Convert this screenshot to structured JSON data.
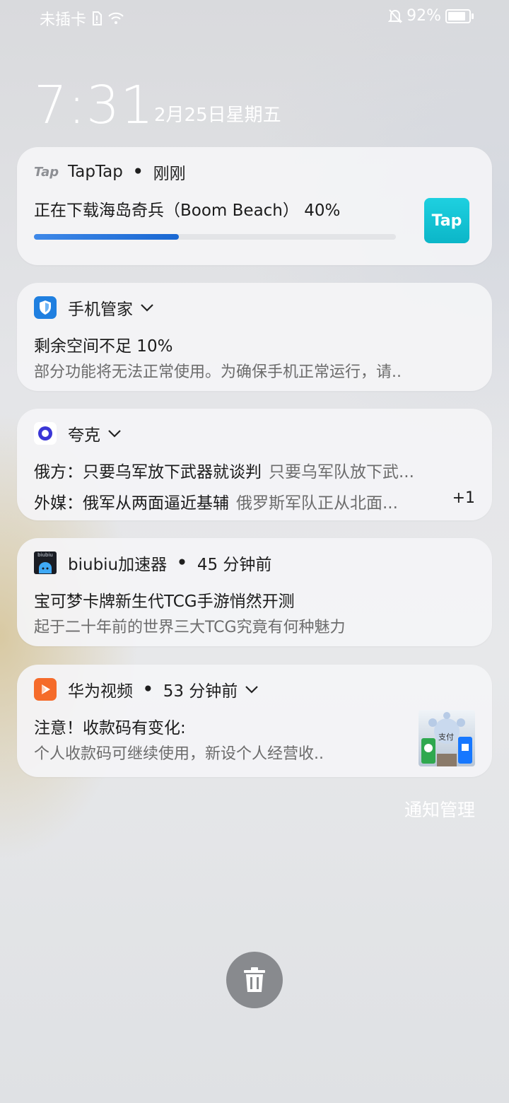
{
  "status_bar": {
    "carrier": "未插卡",
    "battery_percent": "92%",
    "battery_level": 0.92
  },
  "lockscreen": {
    "time": "7:31",
    "date": "2月25日星期五"
  },
  "notifications": [
    {
      "app": "TapTap",
      "time": "刚刚",
      "title": "正在下载海岛奇兵（Boom Beach） 40%",
      "progress": 0.4,
      "icon_text": "Tap",
      "app_icon_text": "Tap"
    },
    {
      "app": "手机管家",
      "title": "剩余空间不足 10%",
      "body": "部分功能将无法正常使用。为确保手机正常运行，请.."
    },
    {
      "app": "夸克",
      "items": [
        {
          "title": "俄方：只要乌军放下武器就谈判",
          "preview": "只要乌军队放下武..."
        },
        {
          "title": "外媒：俄军从两面逼近基辅",
          "preview": "俄罗斯军队正从北面..."
        }
      ],
      "more_count": "+1"
    },
    {
      "app": "biubiu加速器",
      "time": "45 分钟前",
      "title": "宝可梦卡牌新生代TCG手游悄然开测",
      "body": "起于二十年前的世界三大TCG究竟有何种魅力",
      "icon_text": "biubiu"
    },
    {
      "app": "华为视频",
      "time": "53 分钟前",
      "title": "注意！收款码有变化:",
      "body": "个人收款码可继续使用，新设个人经营收..",
      "thumb_text": "支付"
    }
  ],
  "manage_label": "通知管理",
  "colors": {
    "progress": "#1967d2",
    "tap_brand": "#14c3d3",
    "huawei_video": "#f56b2a",
    "manager_blue": "#1f7fe0"
  }
}
